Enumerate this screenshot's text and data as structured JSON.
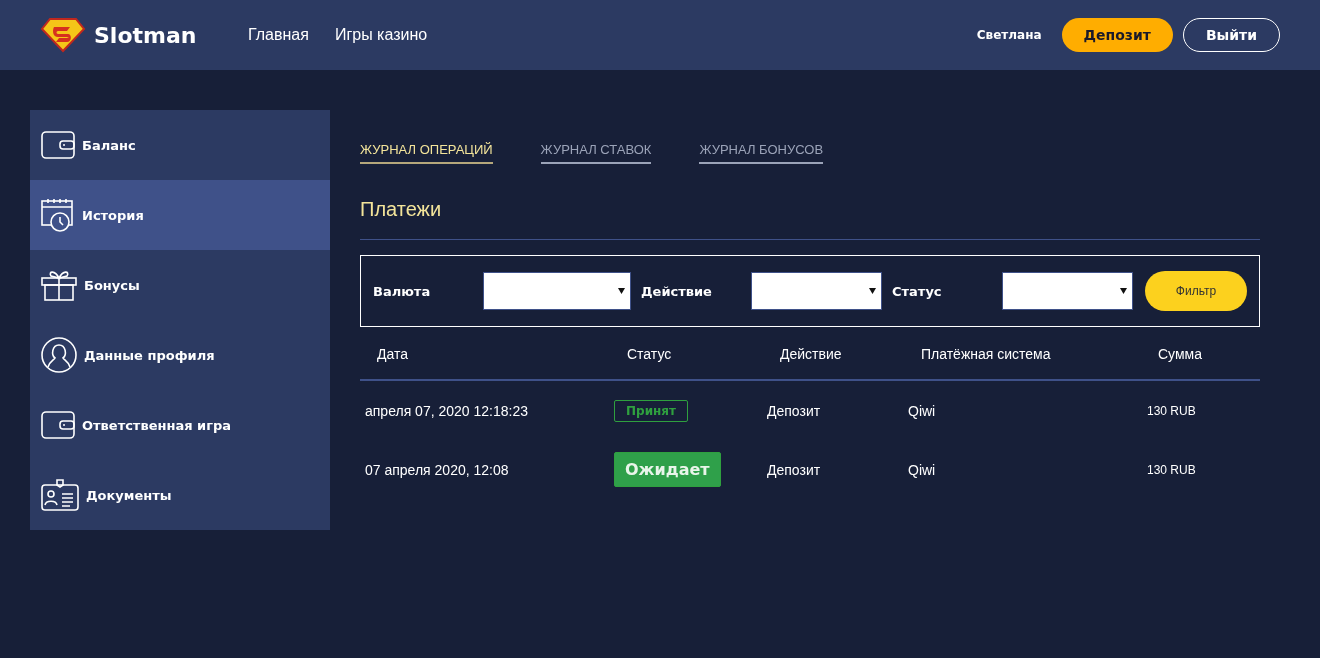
{
  "header": {
    "brand": "Slotman",
    "nav": [
      "Главная",
      "Игры казино"
    ],
    "user": "Светлана",
    "deposit_button": "Депозит",
    "logout_button": "Выйти"
  },
  "sidebar": {
    "items": [
      {
        "label": "Баланс",
        "kind": "wallet",
        "selected": false
      },
      {
        "label": "История",
        "kind": "history",
        "selected": true
      },
      {
        "label": "Бонусы",
        "kind": "gift",
        "selected": false
      },
      {
        "label": "Данные профиля",
        "kind": "profile",
        "selected": false
      },
      {
        "label": "Ответственная игра",
        "kind": "wallet",
        "selected": false
      },
      {
        "label": "Документы",
        "kind": "document",
        "selected": false
      }
    ]
  },
  "tabs": [
    {
      "label": "ЖУРНАЛ ОПЕРАЦИЙ",
      "selected": true
    },
    {
      "label": "ЖУРНАЛ СТАВОК",
      "selected": false
    },
    {
      "label": "ЖУРНАЛ БОНУСОВ",
      "selected": false
    }
  ],
  "section_title": "Платежи",
  "filters": {
    "fields": [
      {
        "label": "Валюта"
      },
      {
        "label": "Действие"
      },
      {
        "label": "Статус"
      }
    ],
    "button": "Фильтр"
  },
  "table": {
    "columns": [
      "Дата",
      "Статус",
      "Действие",
      "Платёжная система",
      "Сумма"
    ],
    "rows": [
      {
        "date": "апреля 07, 2020 12:18:23",
        "status": "Принят",
        "kind": "outline",
        "action": "Депозит",
        "system": "Qiwi",
        "amount": "130 RUB"
      },
      {
        "date": "07 апреля 2020, 12:08",
        "status": "Ожидает",
        "kind": "filled",
        "action": "Депозит",
        "system": "Qiwi",
        "amount": "130 RUB"
      }
    ]
  }
}
